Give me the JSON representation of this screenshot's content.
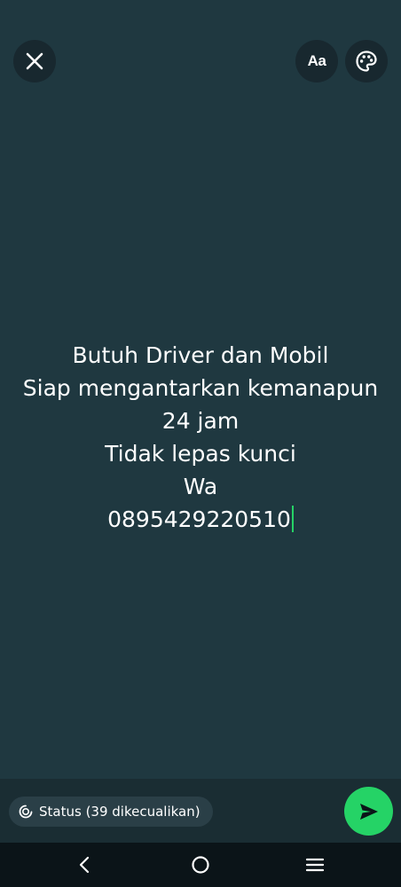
{
  "topbar": {
    "close_icon": "close-icon",
    "font_button_label": "Aa",
    "palette_icon": "palette-icon"
  },
  "status": {
    "lines": [
      "Butuh Driver dan Mobil",
      "Siap mengantarkan kemanapun",
      "24 jam",
      "Tidak lepas kunci",
      "Wa",
      "0895429220510"
    ]
  },
  "bottom": {
    "audience_label": "Status (39 dikecualikan)",
    "audience_icon": "status-icon",
    "send_icon": "send-icon"
  },
  "navbar": {
    "back_icon": "back-icon",
    "home_icon": "home-icon",
    "recents_icon": "recents-icon"
  },
  "colors": {
    "background": "#1f3840",
    "accent": "#25d366",
    "bottom_bar": "#1a2d33",
    "navbar": "#0b1418"
  }
}
